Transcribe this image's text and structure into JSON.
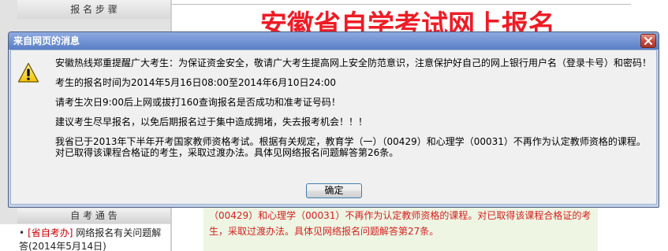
{
  "page": {
    "title": "安徽省自学考试网上报名",
    "sidebar": {
      "steps_header": "报 名 步 骤",
      "notices_header": "自 考 通 告",
      "notices": [
        {
          "bullet": "•",
          "source": "[省自考办]",
          "text": "网络报名有关问题解答(2014年5月14日)"
        }
      ]
    },
    "notice_box": {
      "text": "（00429）和心理学（00031）不再作为认定教师资格的课程。对已取得该课程合格证的考生，采取过渡办法。具体见网络报名问题解答第27条。"
    }
  },
  "dialog": {
    "title": "来自网页的消息",
    "icon": "warning-icon",
    "close_icon": "close-icon",
    "messages": [
      "安徽热线郑重提醒广大考生：为保证资金安全，敬请广大考生提高网上安全防范意识，注意保护好自己的网上银行用户名（登录卡号）和密码！",
      "考生的报名时间为2014年5月16日08:00至2014年6月10日24:00",
      "请考生次日9:00后上网或拔打160查询报名是否成功和准考证号码！",
      "建议考生尽早报名，以免后期报名过于集中造成拥堵，失去报考机会！！！",
      "我省已于2013年下半年开考国家教师资格考试。根据有关规定，教育学（一）（00429）和心理学（00031）不再作为认定教师资格的课程。对已取得该课程合格证的考生，采取过渡办法。具体见网络报名问题解答第26条。"
    ],
    "ok_label": "确定"
  },
  "colors": {
    "title_red": "#ee1c25",
    "notice_text_red": "#d42020",
    "source_link_red": "#cc0000",
    "titlebar_blue_light": "#8eaae0",
    "titlebar_blue": "#5a7ec6",
    "dialog_frame": "#c3d1ea",
    "dialog_body": "#f0f0f0",
    "notice_box_green": "#eef6e3",
    "close_button_red": "#c8473a"
  }
}
